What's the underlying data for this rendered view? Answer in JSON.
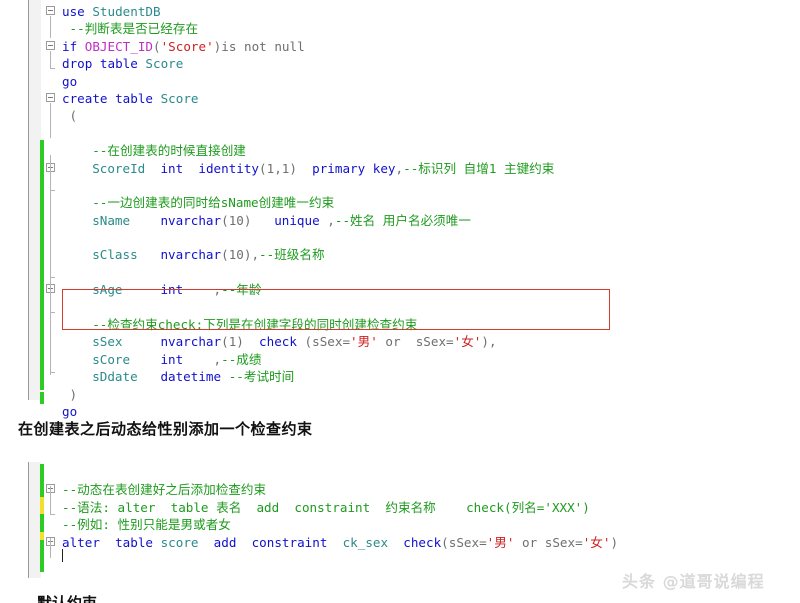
{
  "app": {
    "kind": "sql-editor-screenshot",
    "watermark": "头条 @道哥说编程"
  },
  "colors": {
    "keyword": "#1111cc",
    "identifier": "#2b8a8a",
    "comment": "#1e9b1e",
    "string": "#cc2222",
    "function": "#c030c0",
    "plain": "#6f6f6f",
    "annotation_box": "#d23b2e",
    "track_changed": "#2ecc23",
    "track_unsaved": "#f2e12c"
  },
  "top_editor": {
    "lines": [
      {
        "indent": 0,
        "fold": true,
        "tokens": [
          {
            "t": "use ",
            "c": "kw"
          },
          {
            "t": "StudentDB",
            "c": "ident"
          }
        ]
      },
      {
        "indent": 1,
        "fold": false,
        "tokens": [
          {
            "t": "--判断表是否已经存在",
            "c": "cmt"
          }
        ]
      },
      {
        "indent": 0,
        "fold": true,
        "tokens": [
          {
            "t": "if ",
            "c": "kw"
          },
          {
            "t": "OBJECT_ID",
            "c": "fn"
          },
          {
            "t": "(",
            "c": "plain"
          },
          {
            "t": "'Score'",
            "c": "str"
          },
          {
            "t": ")is not null",
            "c": "plain"
          }
        ]
      },
      {
        "indent": 0,
        "fold": false,
        "tokens": [
          {
            "t": "drop ",
            "c": "kw"
          },
          {
            "t": "table ",
            "c": "kw"
          },
          {
            "t": "Score",
            "c": "ident"
          }
        ]
      },
      {
        "indent": 0,
        "fold": false,
        "tokens": [
          {
            "t": "go",
            "c": "kw"
          }
        ]
      },
      {
        "indent": 0,
        "fold": true,
        "tokens": [
          {
            "t": "create ",
            "c": "kw"
          },
          {
            "t": "table ",
            "c": "kw"
          },
          {
            "t": "Score",
            "c": "ident"
          }
        ]
      },
      {
        "indent": 1,
        "fold": false,
        "tokens": [
          {
            "t": "(",
            "c": "plain"
          }
        ]
      },
      {
        "indent": 0,
        "fold": false,
        "tokens": []
      },
      {
        "indent": 4,
        "fold": false,
        "tokens": [
          {
            "t": "--在创建表的时候直接创建",
            "c": "cmt"
          }
        ]
      },
      {
        "indent": 4,
        "fold": true,
        "tokens": [
          {
            "t": "ScoreId  ",
            "c": "ident"
          },
          {
            "t": "int  ",
            "c": "kw"
          },
          {
            "t": "identity",
            "c": "kw"
          },
          {
            "t": "(1,1)  ",
            "c": "plain"
          },
          {
            "t": "primary key",
            "c": "kw"
          },
          {
            "t": ",",
            "c": "plain"
          },
          {
            "t": "--标识列 自增1 主键约束",
            "c": "cmt"
          }
        ]
      },
      {
        "indent": 0,
        "fold": false,
        "tokens": []
      },
      {
        "indent": 4,
        "fold": false,
        "tokens": [
          {
            "t": "--一边创建表的同时给sName创建唯一约束",
            "c": "cmt"
          }
        ]
      },
      {
        "indent": 4,
        "fold": false,
        "tokens": [
          {
            "t": "sName    ",
            "c": "ident"
          },
          {
            "t": "nvarchar",
            "c": "kw"
          },
          {
            "t": "(10)   ",
            "c": "plain"
          },
          {
            "t": "unique ",
            "c": "kw"
          },
          {
            "t": ",",
            "c": "plain"
          },
          {
            "t": "--姓名 用户名必须唯一",
            "c": "cmt"
          }
        ]
      },
      {
        "indent": 0,
        "fold": false,
        "tokens": []
      },
      {
        "indent": 4,
        "fold": false,
        "tokens": [
          {
            "t": "sClass   ",
            "c": "ident"
          },
          {
            "t": "nvarchar",
            "c": "kw"
          },
          {
            "t": "(10),",
            "c": "plain"
          },
          {
            "t": "--班级名称",
            "c": "cmt"
          }
        ]
      },
      {
        "indent": 0,
        "fold": false,
        "tokens": []
      },
      {
        "indent": 4,
        "fold": true,
        "tokens": [
          {
            "t": "sAge     ",
            "c": "ident"
          },
          {
            "t": "int",
            "c": "kw"
          },
          {
            "t": "    ,",
            "c": "plain"
          },
          {
            "t": "--年龄",
            "c": "cmt"
          }
        ]
      },
      {
        "indent": 0,
        "fold": false,
        "tokens": []
      },
      {
        "indent": 4,
        "fold": false,
        "tokens": [
          {
            "t": "--检查约束check:下列是在创建字段的同时创建检查约束",
            "c": "cmt"
          }
        ]
      },
      {
        "indent": 4,
        "fold": false,
        "tokens": [
          {
            "t": "sSex     ",
            "c": "ident"
          },
          {
            "t": "nvarchar",
            "c": "kw"
          },
          {
            "t": "(1)  ",
            "c": "plain"
          },
          {
            "t": "check ",
            "c": "kw"
          },
          {
            "t": "(sSex=",
            "c": "plain"
          },
          {
            "t": "'男'",
            "c": "str"
          },
          {
            "t": " or  sSex=",
            "c": "plain"
          },
          {
            "t": "'女'",
            "c": "str"
          },
          {
            "t": "),",
            "c": "plain"
          }
        ]
      },
      {
        "indent": 4,
        "fold": false,
        "tokens": [
          {
            "t": "sCore    ",
            "c": "ident"
          },
          {
            "t": "int",
            "c": "kw"
          },
          {
            "t": "    ,",
            "c": "plain"
          },
          {
            "t": "--成绩",
            "c": "cmt"
          }
        ]
      },
      {
        "indent": 4,
        "fold": false,
        "tokens": [
          {
            "t": "sDdate   ",
            "c": "ident"
          },
          {
            "t": "datetime ",
            "c": "kw"
          },
          {
            "t": "--考试时间",
            "c": "cmt"
          }
        ]
      },
      {
        "indent": 1,
        "fold": false,
        "tokens": [
          {
            "t": ")",
            "c": "plain"
          }
        ]
      },
      {
        "indent": 0,
        "fold": false,
        "tokens": [
          {
            "t": "go",
            "c": "kw"
          }
        ]
      }
    ]
  },
  "heading": {
    "text": "在创建表之后动态给性别添加一个检查约束"
  },
  "bottom_editor": {
    "lines": [
      {
        "indent": 0,
        "fold": false,
        "tokens": []
      },
      {
        "indent": 0,
        "fold": true,
        "tokens": [
          {
            "t": "--动态在表创建好之后添加检查约束",
            "c": "cmt"
          }
        ]
      },
      {
        "indent": 0,
        "fold": false,
        "tokens": [
          {
            "t": "--语法: ",
            "c": "cmt"
          },
          {
            "t": "alter  table ",
            "c": "cmt"
          },
          {
            "t": "表名  ",
            "c": "cmt"
          },
          {
            "t": "add  constraint  ",
            "c": "cmt"
          },
          {
            "t": "约束名称    ",
            "c": "cmt"
          },
          {
            "t": "check(列名='XXX')",
            "c": "cmt"
          }
        ]
      },
      {
        "indent": 0,
        "fold": false,
        "tokens": [
          {
            "t": "--例如: 性别只能是男或者女",
            "c": "cmt"
          }
        ]
      },
      {
        "indent": 0,
        "fold": true,
        "tokens": [
          {
            "t": "alter  ",
            "c": "kw"
          },
          {
            "t": "table ",
            "c": "kw"
          },
          {
            "t": "score  ",
            "c": "ident"
          },
          {
            "t": "add  ",
            "c": "kw"
          },
          {
            "t": "constraint  ",
            "c": "kw"
          },
          {
            "t": "ck_sex  ",
            "c": "ident"
          },
          {
            "t": "check",
            "c": "kw"
          },
          {
            "t": "(sSex=",
            "c": "plain"
          },
          {
            "t": "'男'",
            "c": "str"
          },
          {
            "t": " or sSex=",
            "c": "plain"
          },
          {
            "t": "'女'",
            "c": "str"
          },
          {
            "t": ")",
            "c": "plain"
          }
        ]
      },
      {
        "indent": 0,
        "fold": false,
        "tokens": []
      }
    ]
  },
  "footer_heading": {
    "text": "默认约束"
  }
}
